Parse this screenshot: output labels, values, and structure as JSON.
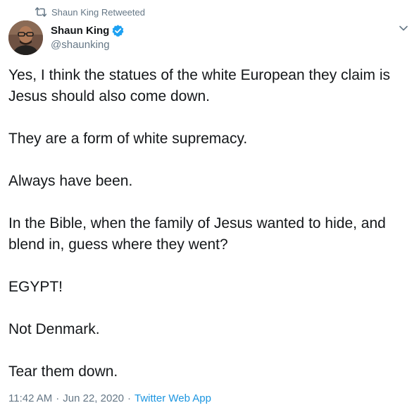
{
  "retweet": {
    "icon": "retweet-icon",
    "label": "Shaun King Retweeted"
  },
  "author": {
    "name": "Shaun King",
    "handle": "@shaunking",
    "verified_icon": "verified-badge-icon",
    "avatar": "profile-photo"
  },
  "menu": {
    "icon": "chevron-down-icon"
  },
  "tweet": {
    "paragraphs": [
      "Yes, I think the statues of the white European they claim is Jesus should also come down.",
      "They are a form of white supremacy.",
      "Always have been.",
      "In the Bible, when the family of Jesus wanted to hide, and blend in, guess where they went?",
      "EGYPT!",
      "Not Denmark.",
      "Tear them down."
    ]
  },
  "meta": {
    "time": "11:42 AM",
    "separator": "·",
    "date": "Jun 22, 2020",
    "source": "Twitter Web App"
  },
  "colors": {
    "text_primary": "#14171a",
    "text_secondary": "#657786",
    "link": "#1b95e0",
    "verified": "#1da1f2"
  }
}
